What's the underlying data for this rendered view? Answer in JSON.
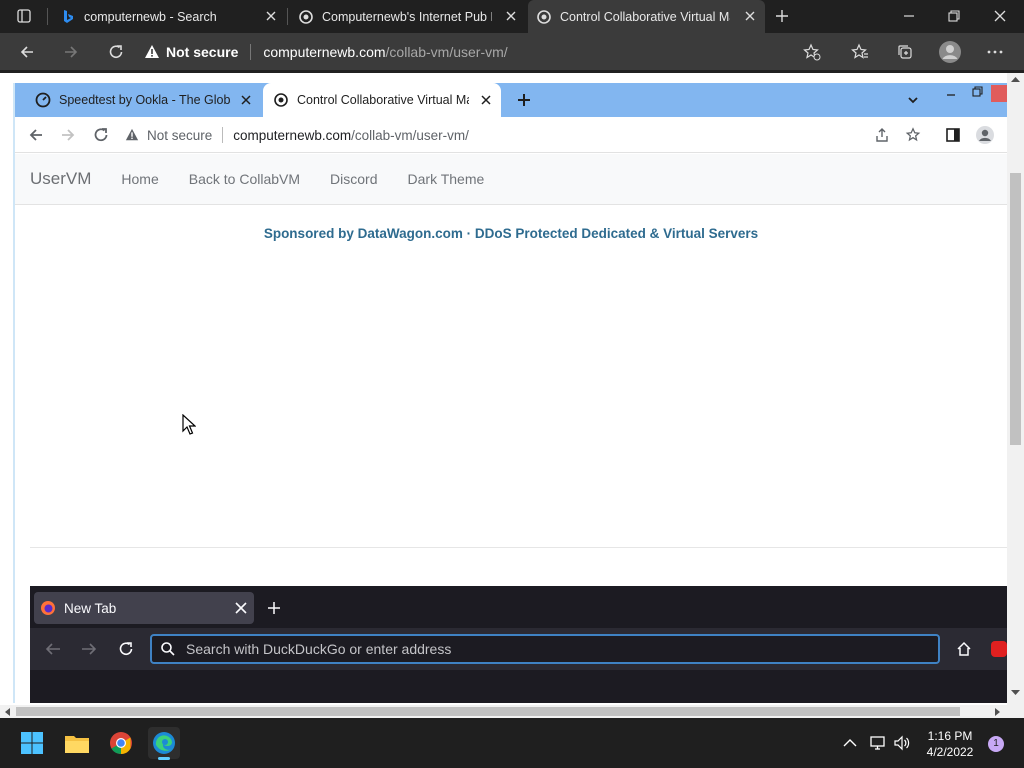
{
  "edge": {
    "tabs": [
      {
        "title": "computernewb - Search"
      },
      {
        "title": "Computernewb's Internet Pub Hub"
      },
      {
        "title": "Control Collaborative Virtual Machine"
      }
    ],
    "address": {
      "security": "Not secure",
      "host": "computernewb.com",
      "path": "/collab-vm/user-vm/"
    }
  },
  "vm_chrome": {
    "tabs": [
      {
        "title": "Speedtest by Ookla - The Global Broadband Speed Test"
      },
      {
        "title": "Control Collaborative Virtual Machine"
      }
    ],
    "address": {
      "security": "Not secure",
      "host": "computernewb.com",
      "path": "/collab-vm/user-vm/"
    }
  },
  "site": {
    "brand": "UserVM",
    "nav": [
      "Home",
      "Back to CollabVM",
      "Discord",
      "Dark Theme"
    ],
    "sponsor": "Sponsored by DataWagon.com · DDoS Protected Dedicated & Virtual Servers"
  },
  "firefox": {
    "tab_title": "New Tab",
    "search_placeholder": "Search with DuckDuckGo or enter address"
  },
  "taskbar": {
    "time": "1:16 PM",
    "date": "4/2/2022",
    "notification_count": "1"
  },
  "colors": {
    "edge_dark": "#202020",
    "vm_tab_strip": "#82b6f0",
    "sponsor_text": "#2e6b8f",
    "firefox_bg": "#1c1b22",
    "focus_ring": "#3f82c4"
  }
}
